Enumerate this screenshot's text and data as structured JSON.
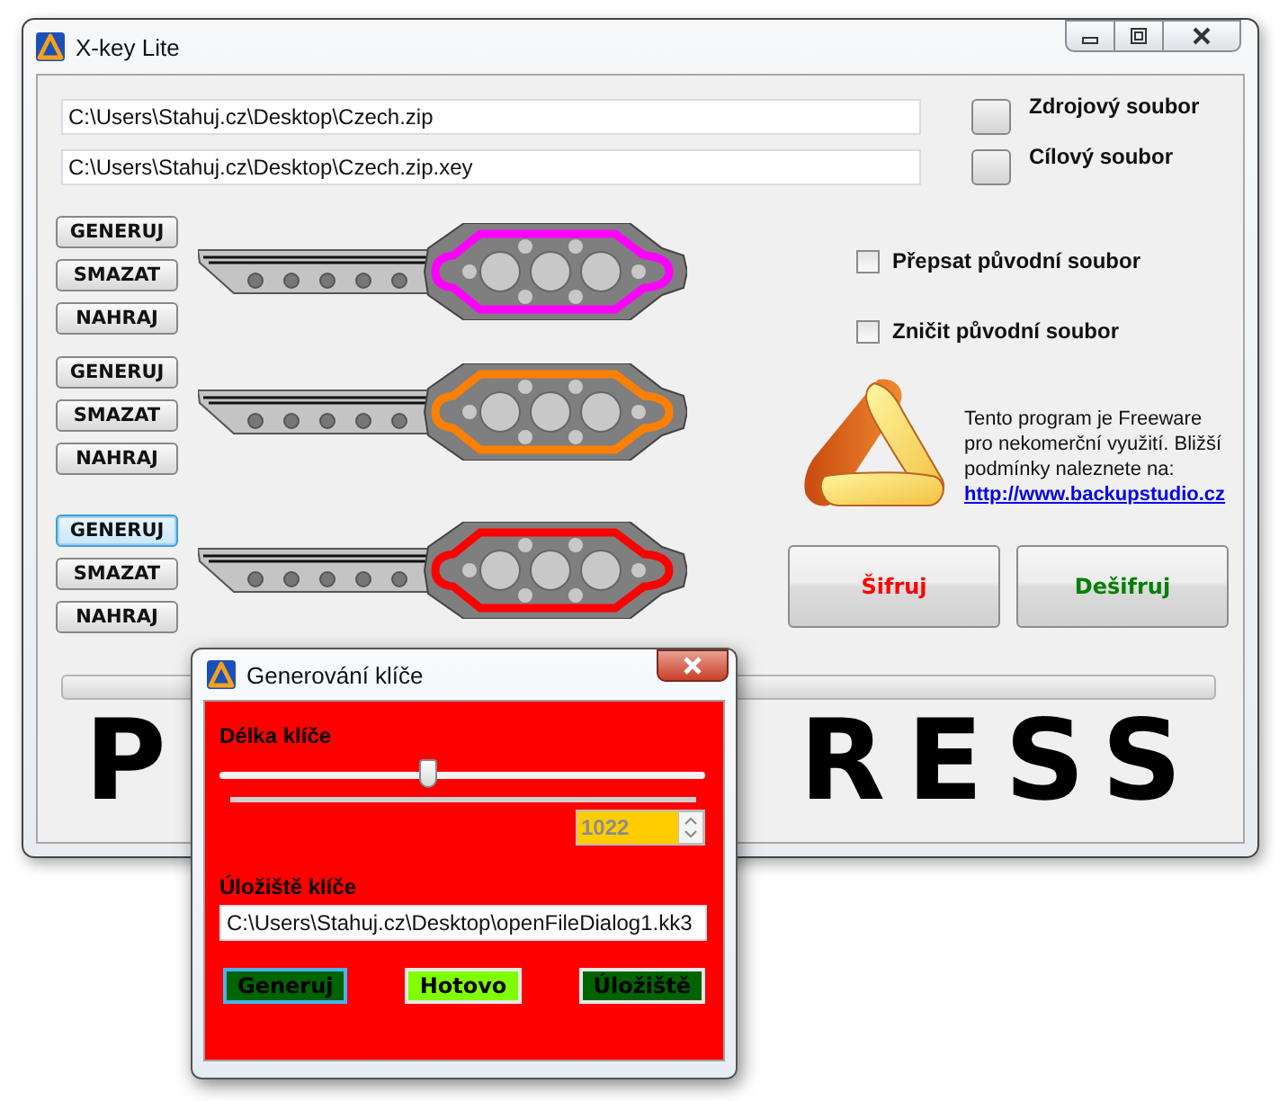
{
  "window": {
    "title": "X-key Lite"
  },
  "files": [
    {
      "path": "C:\\Users\\Stahuj.cz\\Desktop\\Czech.zip",
      "label": "Zdrojový soubor"
    },
    {
      "path": "C:\\Users\\Stahuj.cz\\Desktop\\Czech.zip.xey",
      "label": "Cílový soubor"
    }
  ],
  "keys": [
    {
      "color": "#ff00ff",
      "buttons": [
        {
          "label": "GENERUJ",
          "focused": false
        },
        {
          "label": "SMAZAT",
          "focused": false
        },
        {
          "label": "NAHRAJ",
          "focused": false
        }
      ]
    },
    {
      "color": "#ff8000",
      "buttons": [
        {
          "label": "GENERUJ",
          "focused": false
        },
        {
          "label": "SMAZAT",
          "focused": false
        },
        {
          "label": "NAHRAJ",
          "focused": false
        }
      ]
    },
    {
      "color": "#ff0000",
      "buttons": [
        {
          "label": "GENERUJ",
          "focused": true
        },
        {
          "label": "SMAZAT",
          "focused": false
        },
        {
          "label": "NAHRAJ",
          "focused": false
        }
      ]
    }
  ],
  "options": [
    {
      "label": "Přepsat původní soubor",
      "checked": false
    },
    {
      "label": "Zničit původní soubor",
      "checked": false
    }
  ],
  "info": {
    "text": "Tento program je Freeware pro nekomerční využití. Bližší podmínky naleznete na:",
    "link": "http://www.backupstudio.cz"
  },
  "actions": [
    {
      "label": "Šifruj",
      "color": "#ff0000"
    },
    {
      "label": "Dešifruj",
      "color": "#008000"
    }
  ],
  "progress": {
    "level": 0
  },
  "banner": [
    "P",
    "RESS"
  ],
  "dialog": {
    "title": "Generování klíče",
    "length_label": "Délka klíče",
    "slider": {
      "level": 0.43
    },
    "length_value": "1022",
    "storage_label": "Úložiště klíče",
    "storage_path": "C:\\Users\\Stahuj.cz\\Desktop\\openFileDialog1.kk3",
    "buttons": [
      {
        "label": "Generuj",
        "color": "#006400",
        "focused": true
      },
      {
        "label": "Hotovo",
        "color": "#80ff00",
        "focused": false
      },
      {
        "label": "Úložiště",
        "color": "#006400",
        "focused": false
      }
    ]
  }
}
